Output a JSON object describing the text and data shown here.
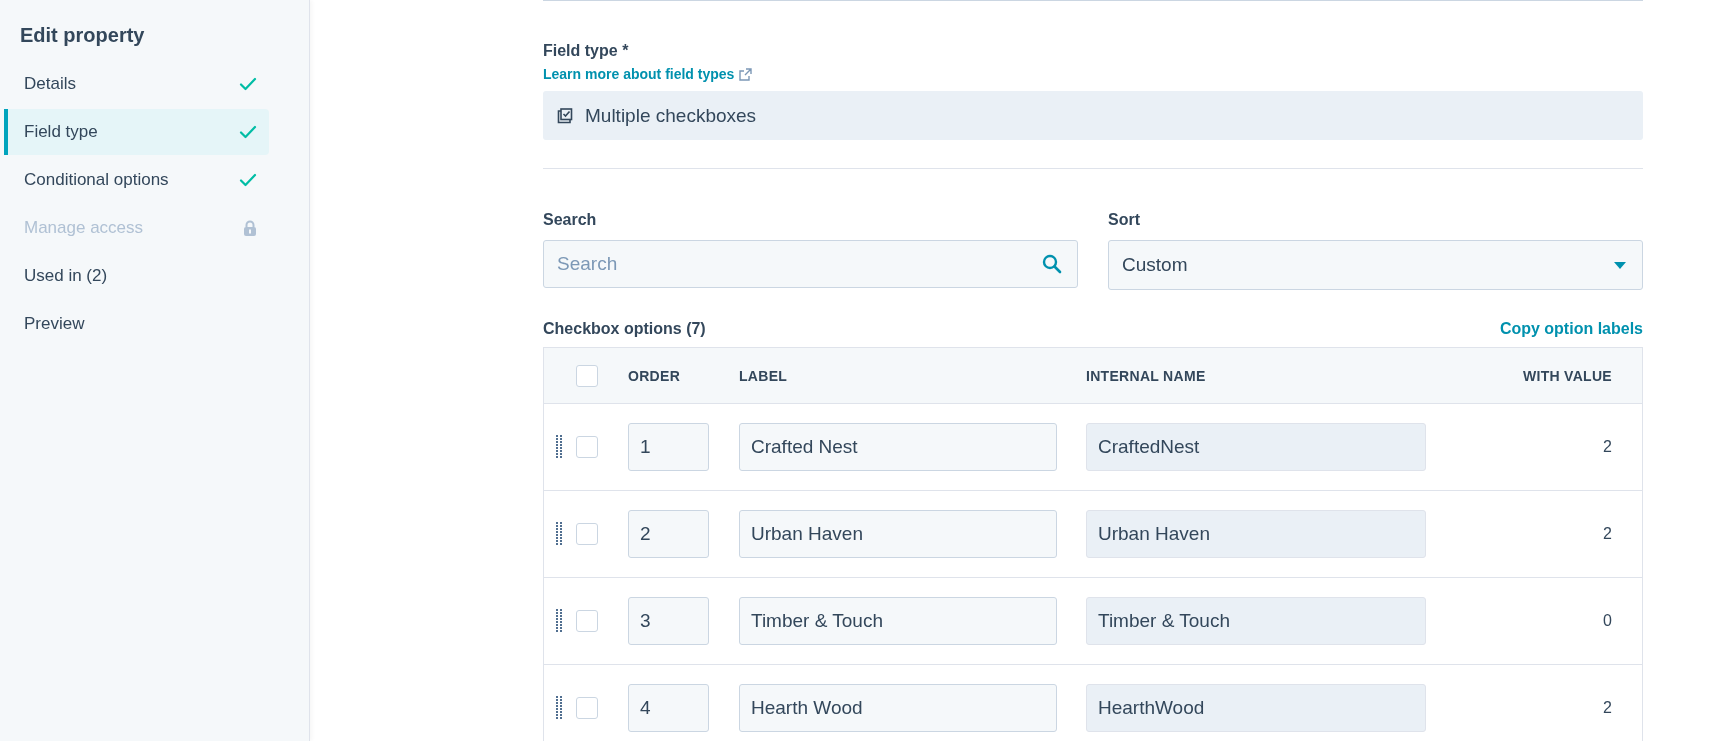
{
  "sidebar": {
    "title": "Edit property",
    "items": [
      {
        "label": "Details",
        "selected": false,
        "disabled": false,
        "completed": true
      },
      {
        "label": "Field type",
        "selected": true,
        "disabled": false,
        "completed": true
      },
      {
        "label": "Conditional options",
        "selected": false,
        "disabled": false,
        "completed": true
      },
      {
        "label": "Manage access",
        "selected": false,
        "disabled": true,
        "completed": false
      },
      {
        "label": "Used in (2)",
        "selected": false,
        "disabled": false,
        "completed": false
      },
      {
        "label": "Preview",
        "selected": false,
        "disabled": false,
        "completed": false
      }
    ]
  },
  "field_type": {
    "label": "Field type *",
    "link": "Learn more about field types",
    "value": "Multiple checkboxes"
  },
  "search": {
    "label": "Search",
    "placeholder": "Search"
  },
  "sort": {
    "label": "Sort",
    "value": "Custom"
  },
  "options": {
    "title": "Checkbox options (7)",
    "action": "Copy option labels",
    "columns": [
      "ORDER",
      "LABEL",
      "INTERNAL NAME",
      "WITH VALUE"
    ],
    "header_checked": false,
    "rows": [
      {
        "checked": false,
        "order": "1",
        "label": "Crafted Nest",
        "internal_name": "CraftedNest",
        "with_value": "2"
      },
      {
        "checked": false,
        "order": "2",
        "label": "Urban Haven",
        "internal_name": "Urban Haven",
        "with_value": "2"
      },
      {
        "checked": false,
        "order": "3",
        "label": "Timber & Touch",
        "internal_name": "Timber & Touch",
        "with_value": "0"
      },
      {
        "checked": false,
        "order": "4",
        "label": "Hearth Wood",
        "internal_name": "HearthWood",
        "with_value": "2"
      }
    ]
  }
}
